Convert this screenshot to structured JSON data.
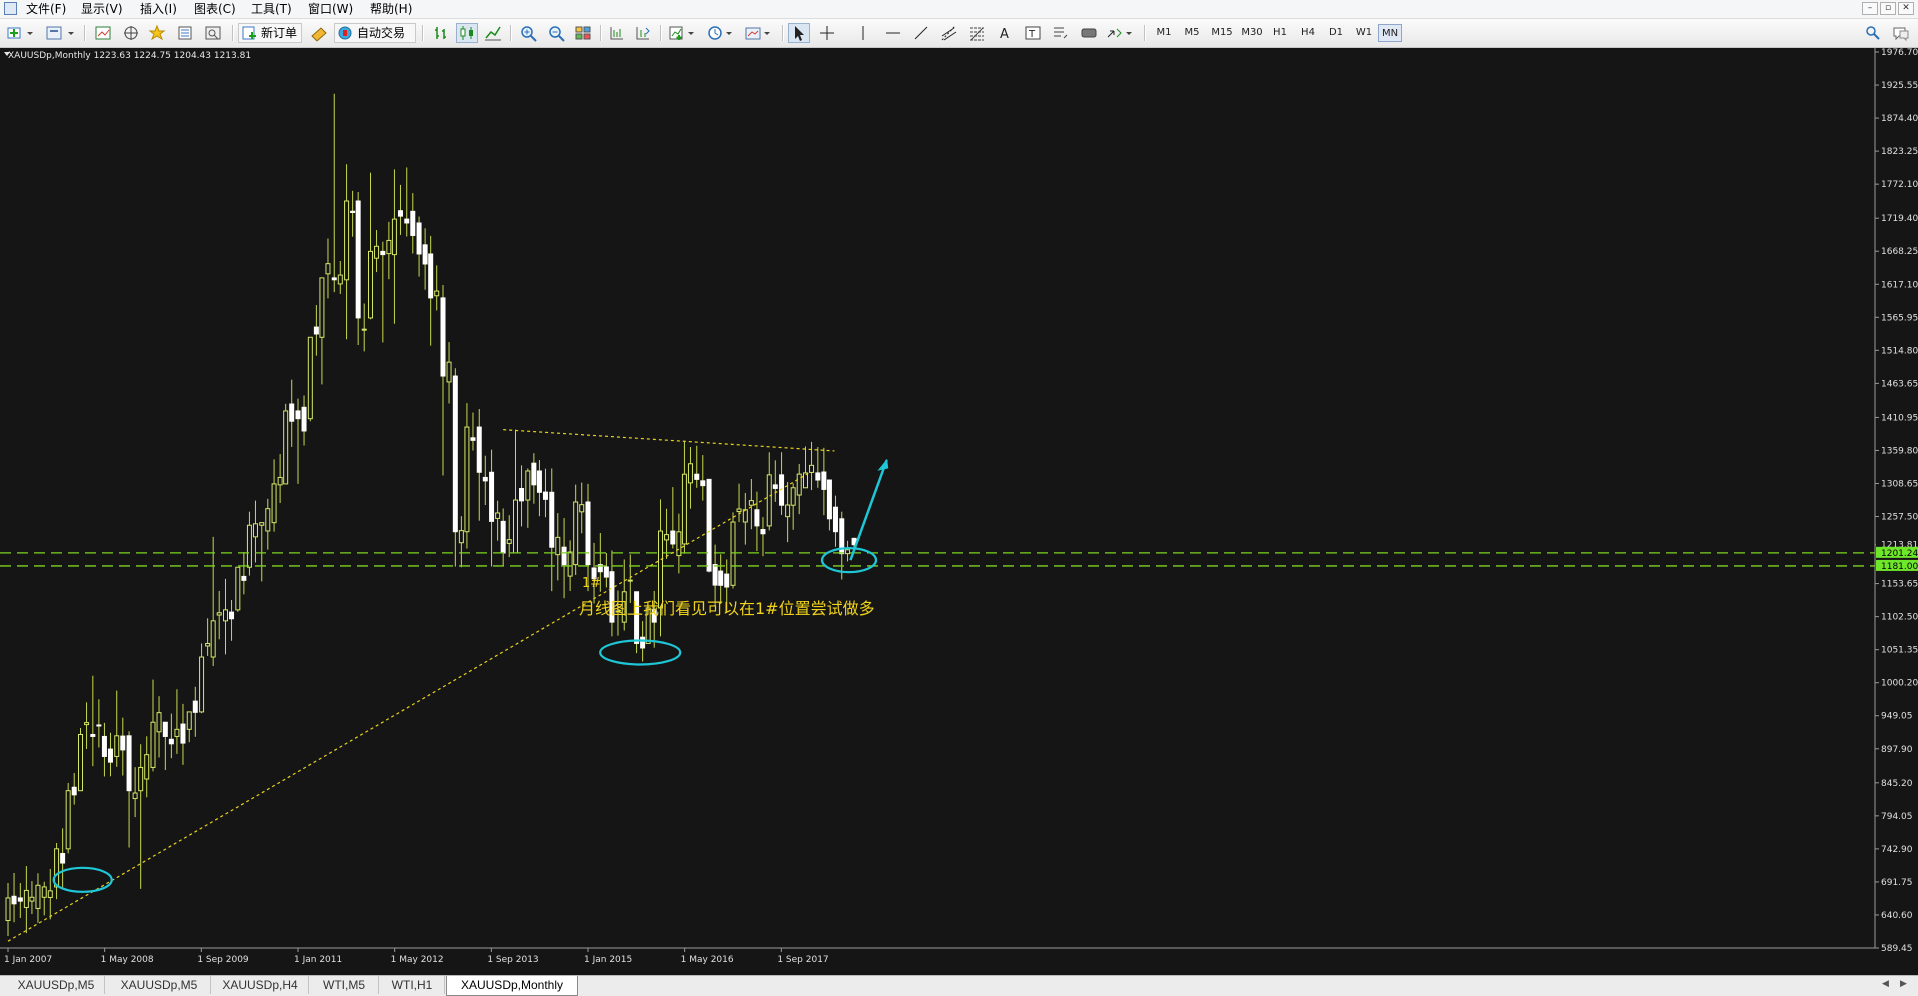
{
  "menu": {
    "items": [
      "文件(F)",
      "显示(V)",
      "插入(I)",
      "图表(C)",
      "工具(T)",
      "窗口(W)",
      "帮助(H)"
    ]
  },
  "window_controls": {
    "minimize": "–",
    "restore": "▫",
    "close": "✕"
  },
  "toolbar": {
    "new_order_label": "新订单",
    "auto_trade_label": "自动交易",
    "icons": [
      "new-chart-icon",
      "profiles-icon",
      "market-watch-icon",
      "navigator-icon",
      "favorites-icon",
      "data-window-icon",
      "strategy-tester-icon",
      "new-order-icon",
      "metaeditor-icon",
      "auto-trading-icon",
      "bar-chart-icon",
      "candlestick-icon",
      "line-chart-icon",
      "zoom-in-icon",
      "zoom-out-icon",
      "tile-windows-icon",
      "chart-shift-icon",
      "autoscroll-icon",
      "indicators-icon",
      "periods-icon",
      "templates-icon",
      "cursor-icon",
      "crosshair-icon",
      "vertical-line-icon",
      "horizontal-line-icon",
      "trendline-icon",
      "equidistant-channel-icon",
      "fibonacci-icon",
      "text-icon",
      "text-label-icon",
      "arrows-icon",
      "shapes-icon",
      "arrow-object-icon",
      "search-icon",
      "chat-icon"
    ],
    "timeframes": [
      "M1",
      "M5",
      "M15",
      "M30",
      "H1",
      "H4",
      "D1",
      "W1",
      "MN"
    ],
    "active_timeframe": "MN"
  },
  "chart": {
    "header": "XAUUSDp,Monthly  1223.63 1224.75 1204.43 1213.81",
    "symbol": "XAUUSDp",
    "period": "Monthly",
    "ohlc": {
      "open": 1223.63,
      "high": 1224.75,
      "low": 1204.43,
      "close": 1213.81
    },
    "colors": {
      "background": "#151515",
      "grid": "#2c2c2c",
      "axis_text": "#e0e0e0",
      "bull_candle": "#d6e866",
      "bear_candle": "#ffffff",
      "wick": "#c8d84e",
      "dashed_level": "#7fd320",
      "trendline": "#e6d21c",
      "annotation_cyan": "#1fc6d6",
      "annotation_text": "#f0d31a",
      "price_tag_bg": "#6ee62a"
    },
    "price_axis": [
      "1976.70",
      "1925.55",
      "1874.40",
      "1823.25",
      "1772.10",
      "1719.40",
      "1668.25",
      "1617.10",
      "1565.95",
      "1514.80",
      "1463.65",
      "1410.95",
      "1359.80",
      "1308.65",
      "1257.50",
      "1213.81",
      "1153.65",
      "1102.50",
      "1051.35",
      "1000.20",
      "949.05",
      "897.90",
      "845.20",
      "794.05",
      "742.90",
      "691.75",
      "640.60",
      "589.45"
    ],
    "time_axis": [
      "1 Jan 2007",
      "1 May 2008",
      "1 Sep 2009",
      "1 Jan 2011",
      "1 May 2012",
      "1 Sep 2013",
      "1 Jan 2015",
      "1 May 2016",
      "1 Sep 2017"
    ],
    "price_tags": [
      "1201.24",
      "1181.00"
    ],
    "current_price_tag": "1213.81",
    "mark_label": "1#",
    "annotation_text": "月线图上我们看见可以在1#位置尝试做多"
  },
  "chart_data": {
    "type": "candlestick",
    "title": "XAUUSDp,Monthly",
    "price_range": [
      589.45,
      1976.7
    ],
    "horizontal_levels": [
      1201.24,
      1181.0
    ],
    "candles": [
      [
        2007.0,
        632,
        690,
        608,
        667
      ],
      [
        2007.17,
        667,
        690,
        636,
        662
      ],
      [
        2007.33,
        662,
        693,
        642,
        668
      ],
      [
        2007.5,
        668,
        692,
        640,
        684
      ],
      [
        2007.67,
        684,
        752,
        665,
        743
      ],
      [
        2007.83,
        743,
        845,
        736,
        833
      ],
      [
        2008.0,
        833,
        930,
        840,
        920
      ],
      [
        2008.17,
        920,
        1011,
        871,
        917
      ],
      [
        2008.33,
        917,
        938,
        855,
        886
      ],
      [
        2008.5,
        886,
        988,
        870,
        918
      ],
      [
        2008.67,
        918,
        925,
        745,
        833
      ],
      [
        2008.83,
        833,
        905,
        681,
        869
      ],
      [
        2009.0,
        869,
        1005,
        863,
        939
      ],
      [
        2009.17,
        939,
        935,
        865,
        917
      ],
      [
        2009.33,
        917,
        990,
        890,
        928
      ],
      [
        2009.5,
        928,
        955,
        908,
        955
      ],
      [
        2009.67,
        955,
        1061,
        953,
        1040
      ],
      [
        2009.83,
        1040,
        1226,
        1026,
        1096
      ],
      [
        2010.0,
        1096,
        1161,
        1044,
        1113
      ],
      [
        2010.17,
        1113,
        1170,
        1110,
        1179
      ],
      [
        2010.33,
        1179,
        1265,
        1166,
        1244
      ],
      [
        2010.5,
        1244,
        1244,
        1157,
        1248
      ],
      [
        2010.67,
        1248,
        1346,
        1234,
        1308
      ],
      [
        2010.83,
        1308,
        1432,
        1349,
        1421
      ],
      [
        2011.0,
        1421,
        1440,
        1308,
        1409
      ],
      [
        2011.17,
        1409,
        1510,
        1405,
        1535
      ],
      [
        2011.33,
        1535,
        1575,
        1462,
        1627
      ],
      [
        2011.5,
        1627,
        1912,
        1605,
        1624
      ],
      [
        2011.67,
        1624,
        1803,
        1532,
        1746
      ],
      [
        2011.83,
        1746,
        1760,
        1523,
        1565
      ],
      [
        2012.0,
        1565,
        1790,
        1563,
        1668
      ],
      [
        2012.17,
        1668,
        1683,
        1527,
        1663
      ],
      [
        2012.33,
        1663,
        1795,
        1556,
        1718
      ],
      [
        2012.5,
        1718,
        1798,
        1691,
        1712
      ],
      [
        2012.67,
        1712,
        1722,
        1629,
        1664
      ],
      [
        2012.83,
        1664,
        1692,
        1522,
        1596
      ],
      [
        2013.0,
        1596,
        1616,
        1321,
        1475
      ],
      [
        2013.17,
        1475,
        1487,
        1180,
        1234
      ],
      [
        2013.33,
        1234,
        1433,
        1208,
        1396
      ],
      [
        2013.5,
        1396,
        1424,
        1251,
        1326
      ],
      [
        2013.67,
        1326,
        1361,
        1180,
        1250
      ],
      [
        2013.83,
        1250,
        1270,
        1181,
        1201
      ],
      [
        2014.0,
        1201,
        1392,
        1202,
        1283
      ],
      [
        2014.17,
        1283,
        1332,
        1240,
        1328
      ],
      [
        2014.33,
        1328,
        1345,
        1258,
        1295
      ],
      [
        2014.5,
        1295,
        1332,
        1142,
        1210
      ],
      [
        2014.67,
        1210,
        1255,
        1131,
        1183
      ],
      [
        2014.83,
        1183,
        1307,
        1167,
        1280
      ],
      [
        2015.0,
        1280,
        1308,
        1142,
        1183
      ],
      [
        2015.17,
        1183,
        1232,
        1141,
        1172
      ],
      [
        2015.33,
        1172,
        1205,
        1072,
        1094
      ],
      [
        2015.5,
        1094,
        1191,
        1081,
        1141
      ],
      [
        2015.67,
        1141,
        1140,
        1046,
        1061
      ],
      [
        2015.83,
        1061,
        1111,
        1061,
        1116
      ],
      [
        2016.0,
        1116,
        1284,
        1072,
        1235
      ],
      [
        2016.17,
        1235,
        1303,
        1208,
        1215
      ],
      [
        2016.33,
        1215,
        1375,
        1200,
        1323
      ],
      [
        2016.5,
        1323,
        1367,
        1302,
        1315
      ],
      [
        2016.67,
        1315,
        1308,
        1171,
        1173
      ],
      [
        2016.83,
        1173,
        1199,
        1122,
        1151
      ],
      [
        2017.0,
        1151,
        1264,
        1146,
        1249
      ],
      [
        2017.17,
        1249,
        1294,
        1214,
        1268
      ],
      [
        2017.33,
        1268,
        1296,
        1204,
        1243
      ],
      [
        2017.5,
        1243,
        1357,
        1236,
        1322
      ],
      [
        2017.67,
        1322,
        1357,
        1260,
        1275
      ],
      [
        2017.83,
        1275,
        1309,
        1237,
        1302
      ],
      [
        2018.0,
        1302,
        1366,
        1304,
        1325
      ],
      [
        2018.17,
        1325,
        1365,
        1302,
        1314
      ],
      [
        2018.33,
        1314,
        1307,
        1236,
        1254
      ],
      [
        2018.5,
        1254,
        1265,
        1160,
        1200
      ],
      [
        2018.58,
        1200,
        1220,
        1188,
        1206
      ],
      [
        2018.67,
        1223.63,
        1224.75,
        1204.43,
        1213.81
      ]
    ]
  }
}
